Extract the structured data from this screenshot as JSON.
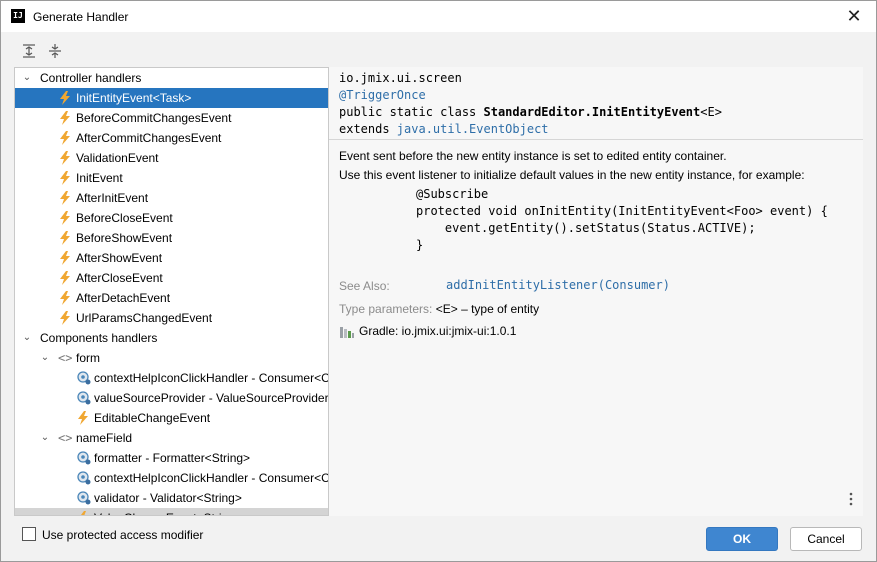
{
  "window": {
    "title": "Generate Handler",
    "app_icon_text": "IJ"
  },
  "tree": {
    "rows": [
      {
        "type": "group",
        "label": "Controller handlers",
        "depth": 0,
        "expanded": true
      },
      {
        "type": "event",
        "label": "InitEntityEvent<Task>",
        "depth": 1,
        "selected": true
      },
      {
        "type": "event",
        "label": "BeforeCommitChangesEvent",
        "depth": 1
      },
      {
        "type": "event",
        "label": "AfterCommitChangesEvent",
        "depth": 1
      },
      {
        "type": "event",
        "label": "ValidationEvent",
        "depth": 1
      },
      {
        "type": "event",
        "label": "InitEvent",
        "depth": 1
      },
      {
        "type": "event",
        "label": "AfterInitEvent",
        "depth": 1
      },
      {
        "type": "event",
        "label": "BeforeCloseEvent",
        "depth": 1
      },
      {
        "type": "event",
        "label": "BeforeShowEvent",
        "depth": 1
      },
      {
        "type": "event",
        "label": "AfterShowEvent",
        "depth": 1
      },
      {
        "type": "event",
        "label": "AfterCloseEvent",
        "depth": 1
      },
      {
        "type": "event",
        "label": "AfterDetachEvent",
        "depth": 1
      },
      {
        "type": "event",
        "label": "UrlParamsChangedEvent",
        "depth": 1
      },
      {
        "type": "group",
        "label": "Components handlers",
        "depth": 0,
        "expanded": true
      },
      {
        "type": "component",
        "label": "form",
        "depth": 1,
        "expanded": true
      },
      {
        "type": "delegate",
        "label": "contextHelpIconClickHandler - Consumer<ContextHelpIconClickEvent>",
        "depth": 2
      },
      {
        "type": "delegate",
        "label": "valueSourceProvider - ValueSourceProvider",
        "depth": 2
      },
      {
        "type": "event",
        "label": "EditableChangeEvent",
        "depth": 2
      },
      {
        "type": "component",
        "label": "nameField",
        "depth": 1,
        "expanded": true
      },
      {
        "type": "delegate",
        "label": "formatter - Formatter<String>",
        "depth": 2
      },
      {
        "type": "delegate",
        "label": "contextHelpIconClickHandler - Consumer<ContextHelpIconClickEvent>",
        "depth": 2
      },
      {
        "type": "delegate",
        "label": "validator - Validator<String>",
        "depth": 2
      },
      {
        "type": "event",
        "label": "ValueChangeEvent<String>",
        "depth": 2,
        "grey": true
      }
    ]
  },
  "doc": {
    "package": "io.jmix.ui.screen",
    "annotation": "@TriggerOnce",
    "decl_prefix": "public static class ",
    "decl_class": "StandardEditor.InitEntityEvent",
    "decl_generic": "<E>",
    "extends_kw": "extends ",
    "extends_type": "java.util.EventObject",
    "description_1": "Event sent before the new entity instance is set to edited entity container.",
    "description_2": "Use this event listener to initialize default values in the new entity instance, for example:",
    "code_1": "@Subscribe",
    "code_2": "protected void onInitEntity(InitEntityEvent<Foo> event) {",
    "code_3": "    event.getEntity().setStatus(Status.ACTIVE);",
    "code_4": "}",
    "see_also_label": "See Also:",
    "see_also_link": "addInitEntityListener(Consumer)",
    "type_params_label": "Type parameters:",
    "type_params_value": "<E> – type of entity",
    "gradle": "Gradle: io.jmix.ui:jmix-ui:1.0.1"
  },
  "footer": {
    "checkbox_label": "Use protected access modifier",
    "checkbox_checked": false,
    "ok_label": "OK",
    "cancel_label": "Cancel"
  },
  "colors": {
    "selection": "#2675bf",
    "bolt": "#f0a732",
    "link": "#2e6ea8",
    "ok_button": "#3f86d0"
  }
}
